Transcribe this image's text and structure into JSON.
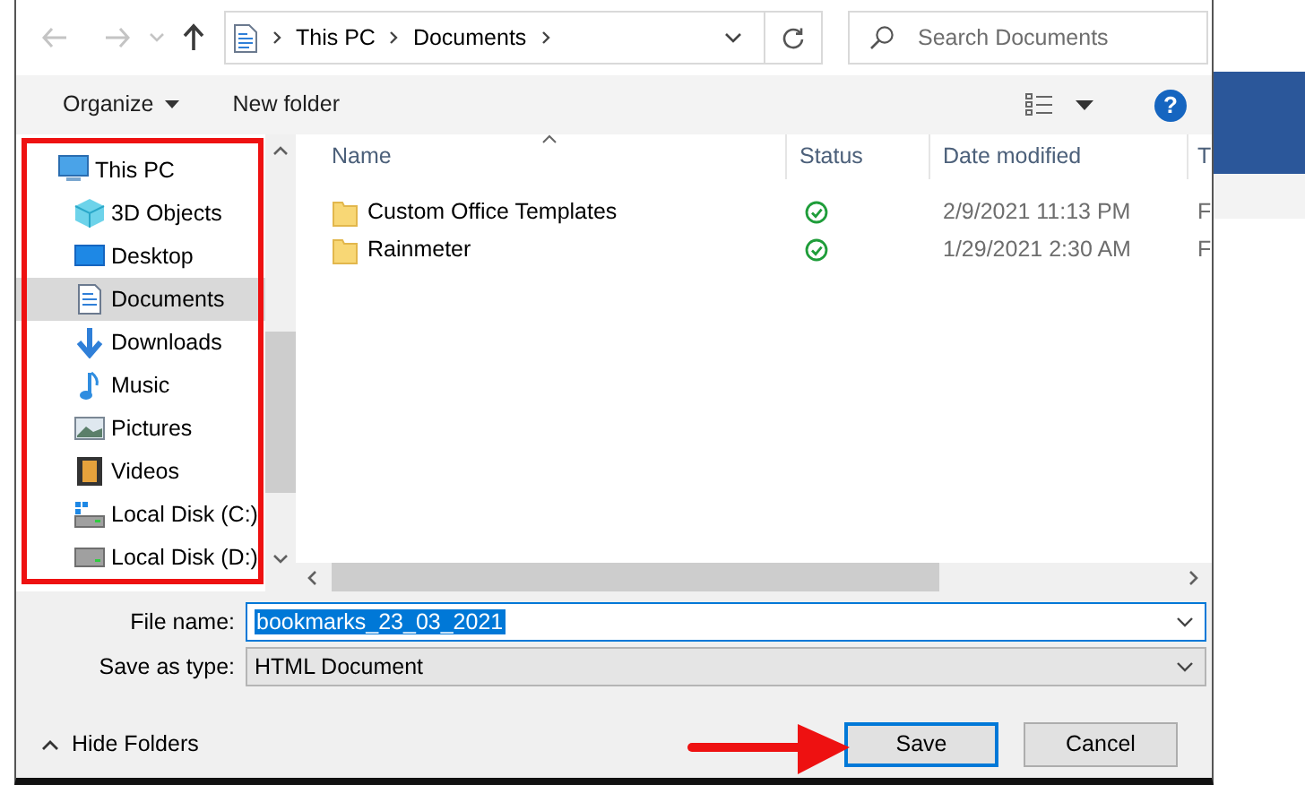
{
  "nav_buttons": [
    {
      "kind": "back",
      "disabled": true
    },
    {
      "kind": "forward",
      "disabled": true
    },
    {
      "kind": "recent",
      "disabled": true
    },
    {
      "kind": "up",
      "disabled": false
    }
  ],
  "address": {
    "path": [
      "This PC",
      "Documents"
    ]
  },
  "search": {
    "placeholder": "Search Documents"
  },
  "commands": [
    {
      "label": "Organize",
      "dropdown": true
    },
    {
      "label": "New folder",
      "dropdown": false
    }
  ],
  "help": {
    "glyph": "?"
  },
  "navigation_tree": [
    {
      "label": "This PC",
      "selected": false,
      "children": [
        {
          "label": "3D Objects",
          "selected": false
        },
        {
          "label": "Desktop",
          "selected": false
        },
        {
          "label": "Documents",
          "selected": true
        },
        {
          "label": "Downloads",
          "selected": false
        },
        {
          "label": "Music",
          "selected": false
        },
        {
          "label": "Pictures",
          "selected": false
        },
        {
          "label": "Videos",
          "selected": false
        },
        {
          "label": "Local Disk (C:)",
          "selected": false
        },
        {
          "label": "Local Disk (D:)",
          "selected": false
        }
      ]
    }
  ],
  "table": {
    "columns": [
      {
        "label": "Name",
        "sorted": true
      },
      {
        "label": "Status",
        "sorted": false
      },
      {
        "label": "Date modified",
        "sorted": false
      },
      {
        "label": "T",
        "sorted": false
      }
    ],
    "rows": [
      {
        "name": "Custom Office Templates",
        "synced": true,
        "date_modified": "2/9/2021 11:13 PM",
        "column_4": "F"
      },
      {
        "name": "Rainmeter",
        "synced": true,
        "date_modified": "1/29/2021 2:30 AM",
        "column_4": "F"
      }
    ]
  },
  "file_name": {
    "label": "File name:",
    "value": "bookmarks_23_03_2021",
    "text_selected": true
  },
  "save_as_type": {
    "label": "Save as type:",
    "value": "HTML Document"
  },
  "hide_folders": {
    "label": "Hide Folders"
  },
  "buttons": [
    {
      "label": "Save",
      "default": true
    },
    {
      "label": "Cancel",
      "default": false
    }
  ]
}
